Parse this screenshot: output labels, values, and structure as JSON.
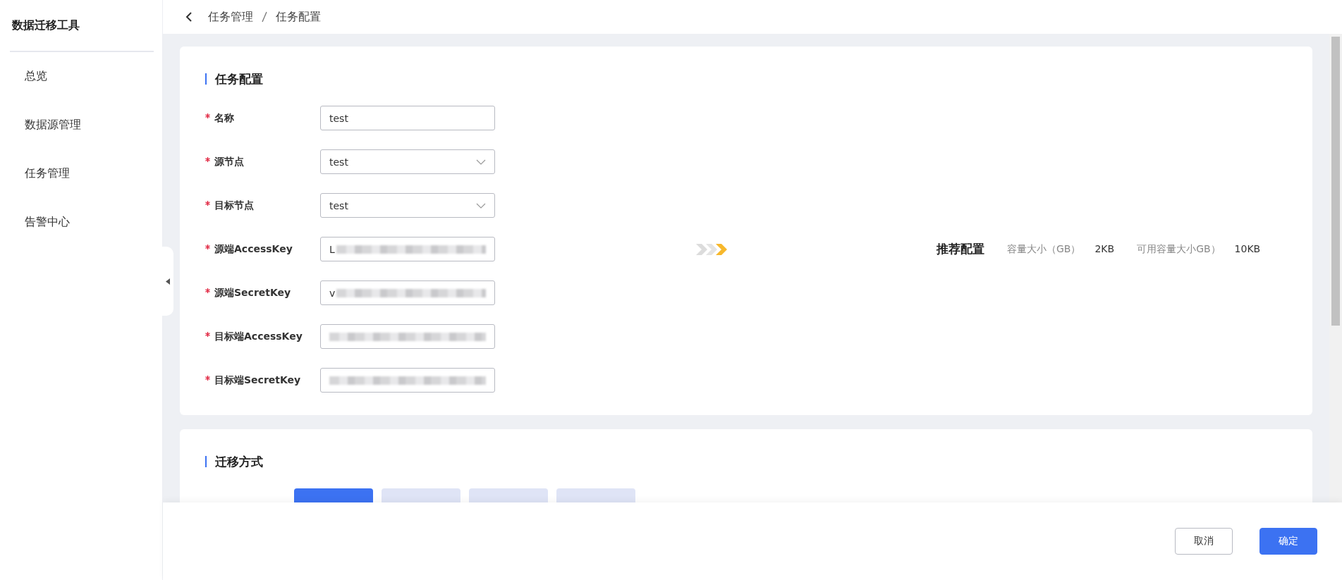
{
  "sidebar": {
    "title": "数据迁移工具",
    "items": [
      {
        "label": "总览",
        "selected": false
      },
      {
        "label": "数据源管理",
        "selected": false
      },
      {
        "label": "任务管理",
        "selected": false
      },
      {
        "label": "告警中心",
        "selected": false
      }
    ]
  },
  "breadcrumb": [
    "任务管理",
    "任务配置"
  ],
  "task_config": {
    "title": "任务配置",
    "fields": [
      {
        "label": "名称",
        "required": true,
        "kind": "input",
        "value": "test",
        "masked": false
      },
      {
        "label": "源节点",
        "required": true,
        "kind": "select",
        "value": "test",
        "masked": false
      },
      {
        "label": "目标节点",
        "required": true,
        "kind": "select",
        "value": "test",
        "masked": false
      },
      {
        "label": "源端AccessKey",
        "required": true,
        "kind": "input",
        "value": "L",
        "masked": true
      },
      {
        "label": "源端SecretKey",
        "required": true,
        "kind": "input",
        "value": "v",
        "masked": true
      },
      {
        "label": "目标端AccessKey",
        "required": true,
        "kind": "input",
        "masked": true
      },
      {
        "label": "目标端SecretKey",
        "required": true,
        "kind": "input",
        "masked": true
      }
    ],
    "recommendation": {
      "title": "推荐配置",
      "items": [
        {
          "label": "容量大小（GB）",
          "value": "2KB"
        },
        {
          "label": "可用容量大小GB）",
          "value": "10KB"
        }
      ]
    }
  },
  "migration_mode": {
    "title": "迁移方式",
    "tabs": [
      {
        "selected": true
      },
      {
        "selected": false
      },
      {
        "selected": false
      },
      {
        "selected": false
      }
    ]
  },
  "footer": {
    "buttons": [
      {
        "label": "取消",
        "kind": "default"
      },
      {
        "label": "确定",
        "kind": "primary"
      }
    ]
  }
}
